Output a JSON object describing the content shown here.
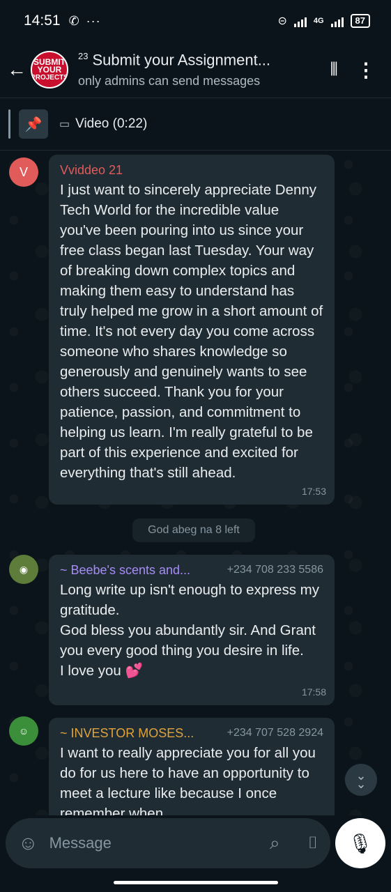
{
  "status_bar": {
    "time": "14:51",
    "whatsapp_icon": "whatsapp-icon",
    "more": "···",
    "network": "4G",
    "battery": "87"
  },
  "header": {
    "group_avatar_lines": [
      "SUBMIT",
      "YOUR",
      "PROJECTS"
    ],
    "count": "23",
    "title": "Submit your Assignment...",
    "subtitle": "only admins can send messages"
  },
  "pinned": {
    "label": "Video (0:22)"
  },
  "messages": [
    {
      "avatar_letter": "V",
      "avatar_color": "#e25b5b",
      "sender": "Vviddeo 21",
      "sender_color": "#e25b5b",
      "text": "I just want to sincerely appreciate Denny Tech World for the incredible value you've been pouring into us since your free class began last Tuesday. Your way of breaking down complex topics and making them easy to understand has truly helped me grow in a short amount of time. It's not every day you come across someone who shares knowledge so generously and genuinely wants to see others succeed. Thank you for your patience, passion, and commitment to helping us learn. I'm really grateful to be part of this experience and excited for everything that's still ahead.",
      "time": "17:53"
    },
    {
      "sender": "~ Beebe's scents and...",
      "sender_color": "#a78bfa",
      "phone": "+234 708 233 5586",
      "text": "Long write up isn't enough to express my gratitude.\nGod bless you abundantly sir. And Grant you every good thing you desire in life.\nI love you 💕",
      "time": "17:58"
    },
    {
      "sender": "~ INVESTOR MOSES...",
      "sender_color": "#e0a33a",
      "phone": "+234 707 528 2924",
      "text": "I want to really appreciate you for all you do for us here to have an opportunity to meet a lecture like because I once remember when"
    }
  ],
  "system_message": "God abeg na 8 left",
  "composer": {
    "placeholder": "Message"
  }
}
